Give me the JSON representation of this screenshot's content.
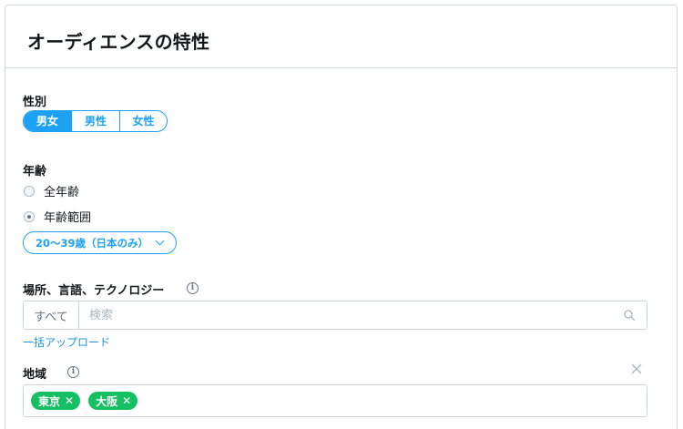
{
  "card": {
    "title": "オーディエンスの特性"
  },
  "gender": {
    "label": "性別",
    "options": [
      "男女",
      "男性",
      "女性"
    ],
    "selected": "男女"
  },
  "age": {
    "label": "年齢",
    "radios": [
      {
        "label": "全年齢",
        "checked": false
      },
      {
        "label": "年齢範囲",
        "checked": true
      }
    ],
    "range_dropdown": "20〜39歳（日本のみ）"
  },
  "targeting": {
    "label": "場所、言語、テクノロジー",
    "info_icon": "info-icon",
    "search_scope": "すべて",
    "search_placeholder": "検索",
    "search_icon": "search-icon",
    "bulk_upload_link": "一括アップロード"
  },
  "region": {
    "label": "地域",
    "info_icon": "info-icon",
    "clear_icon": "close-icon",
    "tags": [
      "東京",
      "大阪"
    ],
    "tag_color": "#17bf63"
  },
  "colors": {
    "accent": "#1da1f2",
    "tag": "#17bf63",
    "border": "#ccd6dd"
  }
}
